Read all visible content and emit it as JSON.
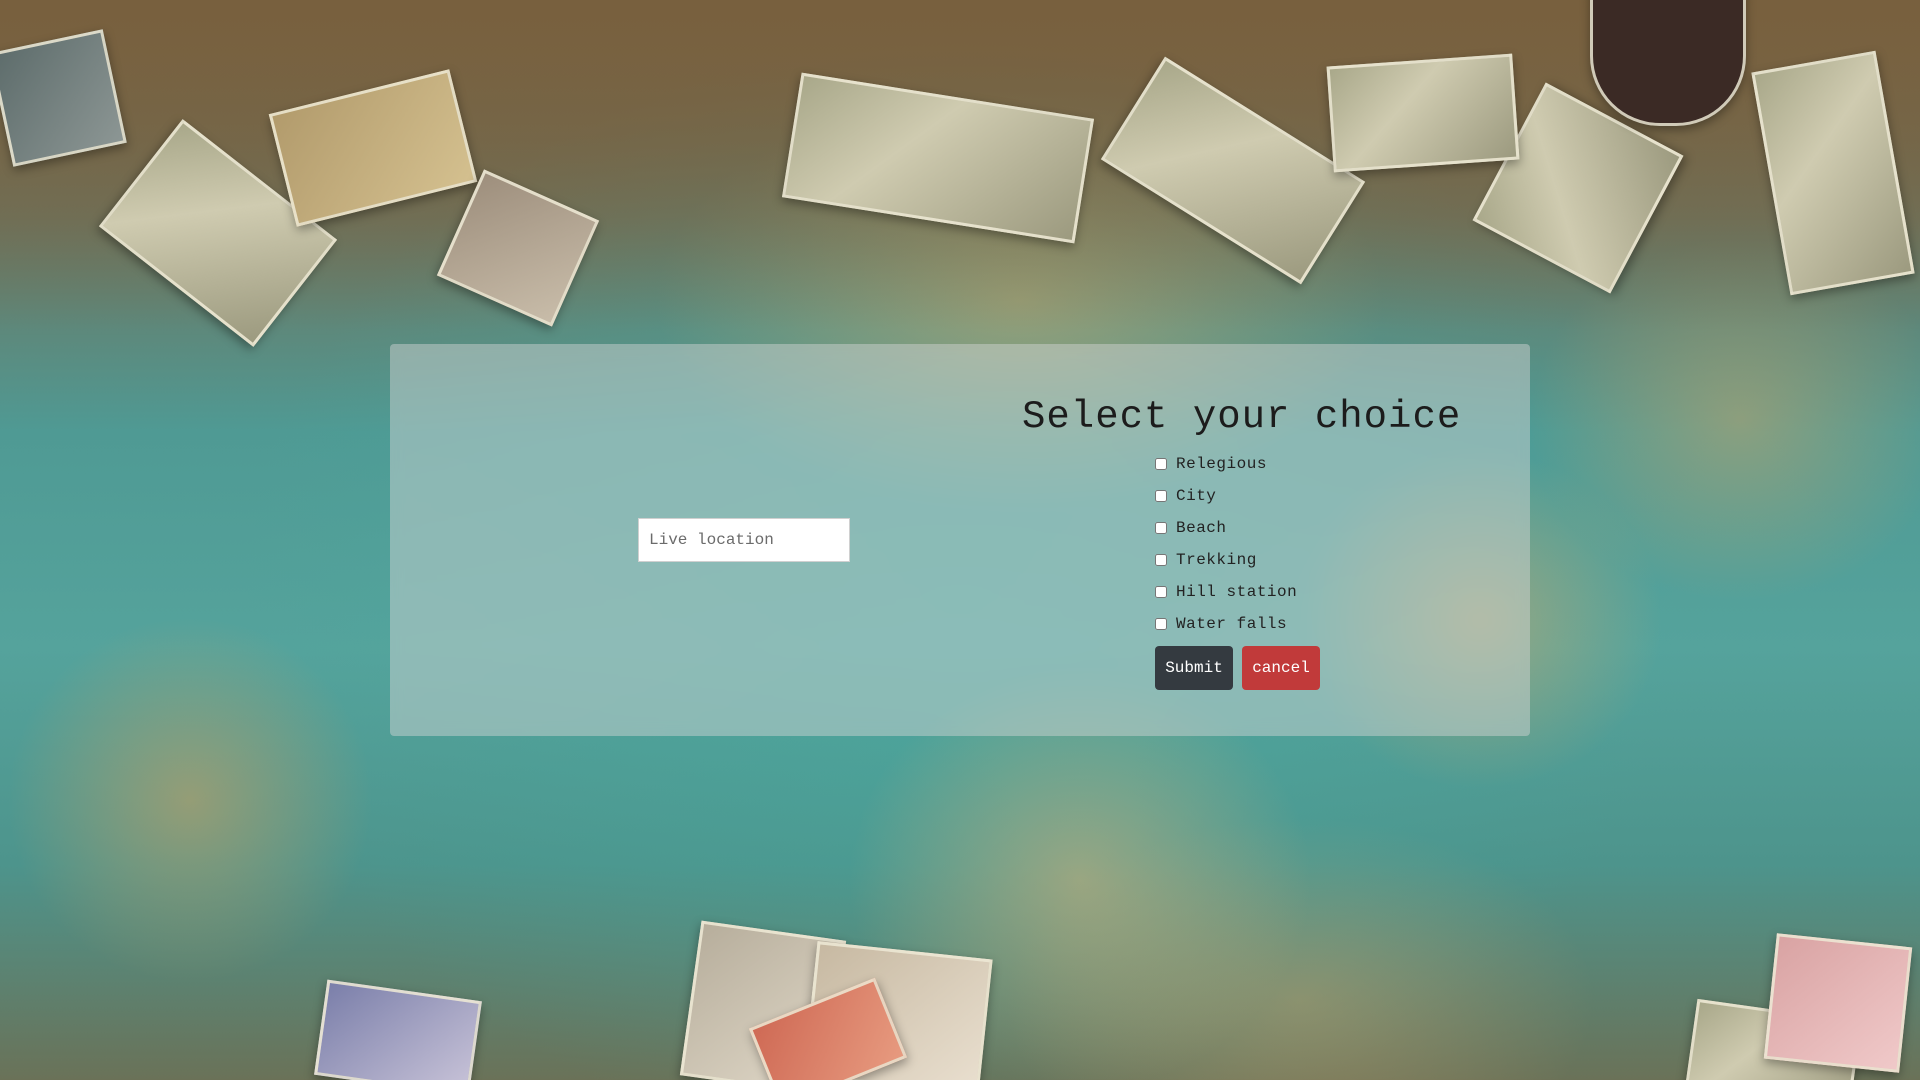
{
  "location": {
    "placeholder": "Live location",
    "value": ""
  },
  "form": {
    "title": "Select your choice",
    "choices": [
      {
        "label": "Relegious",
        "checked": false
      },
      {
        "label": "City",
        "checked": false
      },
      {
        "label": "Beach",
        "checked": false
      },
      {
        "label": "Trekking",
        "checked": false
      },
      {
        "label": "Hill station",
        "checked": false
      },
      {
        "label": "Water falls",
        "checked": false
      }
    ],
    "submit_label": "Submit",
    "cancel_label": "cancel"
  },
  "colors": {
    "submit_bg": "#343a40",
    "cancel_bg": "#c13a3a",
    "panel_bg": "rgba(215,215,215,0.45)"
  },
  "background": {
    "description_icon": "world-map-with-banknotes-background"
  }
}
